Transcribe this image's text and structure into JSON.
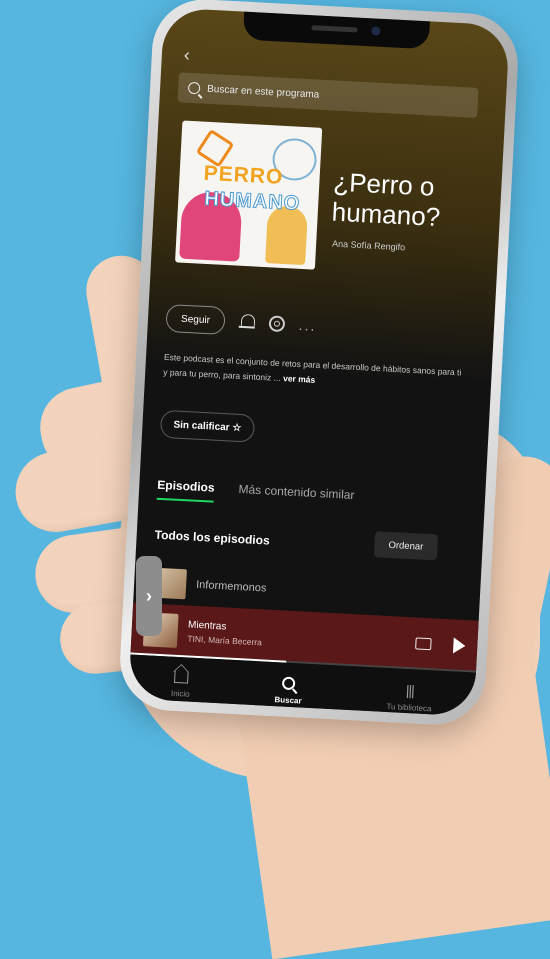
{
  "app": {
    "back_icon": "chevron-left-icon",
    "search": {
      "placeholder": "Buscar en este programa"
    },
    "podcast": {
      "title": "¿Perro o humano?",
      "author": "Ana Sofía Rengifo",
      "cover_text_1": "PERRO",
      "cover_text_2": "HUMANO"
    },
    "actions": {
      "follow_label": "Seguir",
      "more_label": "..."
    },
    "description": {
      "text": "Este podcast es el conjunto de retos para el desarrollo de hábitos sanos para ti y para tu perro, para sintoniz ...",
      "more_label": "ver más"
    },
    "rating_label": "Sin calificar ☆",
    "tabs": [
      {
        "label": "Episodios",
        "active": true
      },
      {
        "label": "Más contenido similar",
        "active": false
      }
    ],
    "episodes": {
      "section_title": "Todos los episodios",
      "order_label": "Ordenar",
      "first_episode_title": "Informemonos"
    },
    "player": {
      "title": "Mientras",
      "subtitle": "TINI, María Becerra",
      "progress": 0.45
    },
    "nav": [
      {
        "label": "Inicio",
        "icon": "home-icon"
      },
      {
        "label": "Buscar",
        "icon": "search-icon",
        "active": true
      },
      {
        "label": "Tu biblioteca",
        "icon": "library-icon"
      }
    ],
    "colors": {
      "background": "#56b6e0",
      "accent": "#1ed760",
      "player_bg": "#5b1818"
    }
  }
}
